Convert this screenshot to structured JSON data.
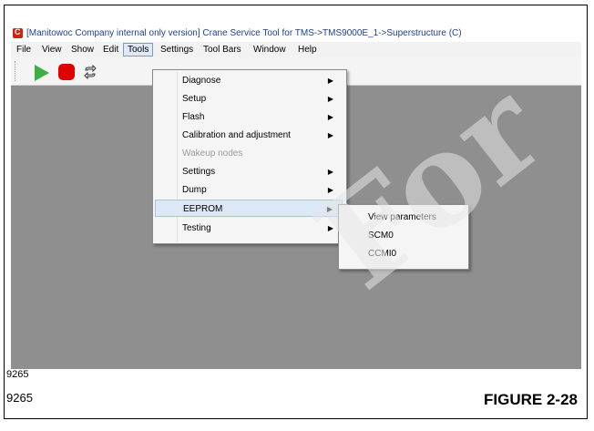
{
  "window": {
    "title": "[Manitowoc Company internal only version] Crane Service Tool for TMS->TMS9000E_1->Superstructure (C)"
  },
  "menubar": [
    "File",
    "View",
    "Show",
    "Edit",
    "Tools",
    "Settings",
    "Tool Bars",
    "Window",
    "Help"
  ],
  "menubar_active": "Tools",
  "toolbar": {
    "icons": [
      "play-icon",
      "stop-icon",
      "refresh-icon"
    ],
    "colors": {
      "play": "#3cb043",
      "stop": "#e00000"
    }
  },
  "tools_menu": {
    "items": [
      {
        "label": "Diagnose",
        "submenu": true,
        "disabled": false
      },
      {
        "label": "Setup",
        "submenu": true,
        "disabled": false
      },
      {
        "label": "Flash",
        "submenu": true,
        "disabled": false
      },
      {
        "label": "Calibration and adjustment",
        "submenu": true,
        "disabled": false
      },
      {
        "label": "Wakeup nodes",
        "submenu": false,
        "disabled": true
      },
      {
        "label": "Settings",
        "submenu": true,
        "disabled": false
      },
      {
        "label": "Dump",
        "submenu": true,
        "disabled": false
      },
      {
        "label": "EEPROM",
        "submenu": true,
        "disabled": false,
        "highlighted": true
      },
      {
        "label": "Testing",
        "submenu": true,
        "disabled": false
      }
    ]
  },
  "eeprom_menu": {
    "items": [
      {
        "label": "View parameters"
      },
      {
        "label": "SCM0"
      },
      {
        "label": "CCMI0"
      }
    ]
  },
  "figure": {
    "number_inside": "9265",
    "number_below": "9265",
    "title": "FIGURE 2-28"
  },
  "watermark": "For"
}
